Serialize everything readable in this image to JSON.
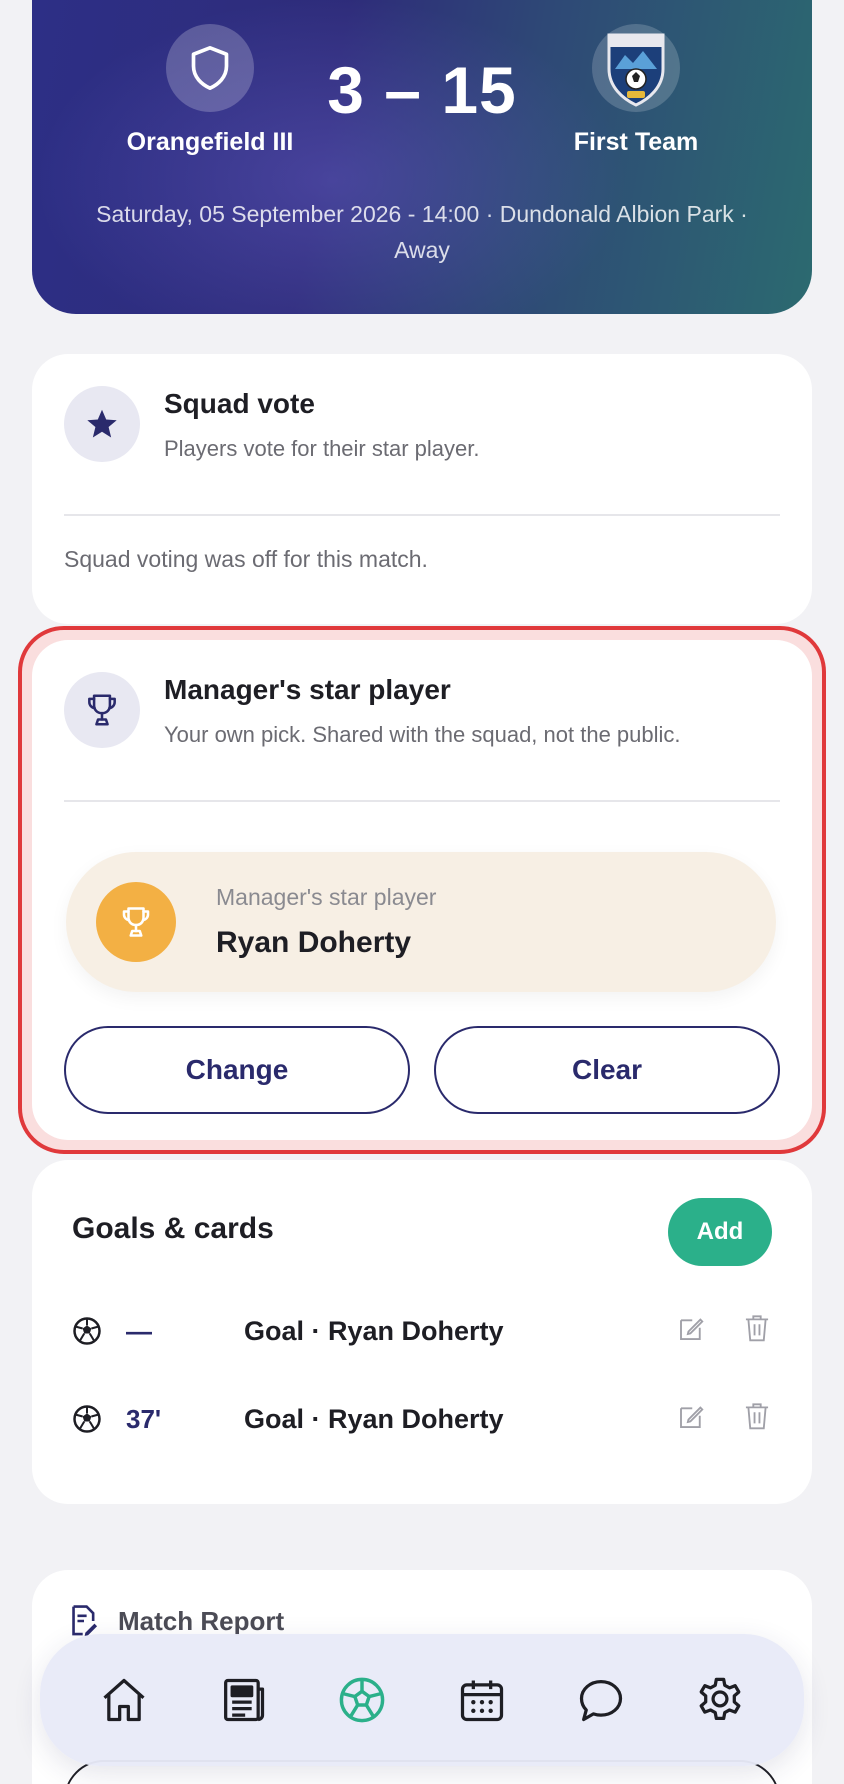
{
  "match": {
    "home_team": "Orangefield III",
    "away_team": "First Team",
    "score": "3 – 15",
    "details": "Saturday, 05 September 2026 - 14:00 · Dundonald Albion Park · Away"
  },
  "squad_vote": {
    "title": "Squad vote",
    "subtitle": "Players vote for their star player.",
    "status": "Squad voting was off for this match."
  },
  "manager_pick": {
    "title": "Manager's star player",
    "subtitle": "Your own pick. Shared with the squad, not the public.",
    "pick_label": "Manager's star player",
    "player_name": "Ryan Doherty",
    "change_label": "Change",
    "clear_label": "Clear"
  },
  "goals_cards": {
    "title": "Goals & cards",
    "add_label": "Add",
    "events": [
      {
        "minute": "—",
        "description": "Goal · Ryan Doherty"
      },
      {
        "minute": "37'",
        "description": "Goal · Ryan Doherty"
      }
    ]
  },
  "match_report": {
    "title": "Match Report"
  },
  "nav": {
    "items": [
      "home-icon",
      "news-icon",
      "football-icon",
      "calendar-icon",
      "chat-icon",
      "settings-icon"
    ],
    "active": "football-icon"
  },
  "colors": {
    "brand_navy": "#2a2a6c",
    "accent_green": "#2bb08a",
    "trophy_gold": "#f3b044",
    "highlight_red": "#e0393b"
  }
}
